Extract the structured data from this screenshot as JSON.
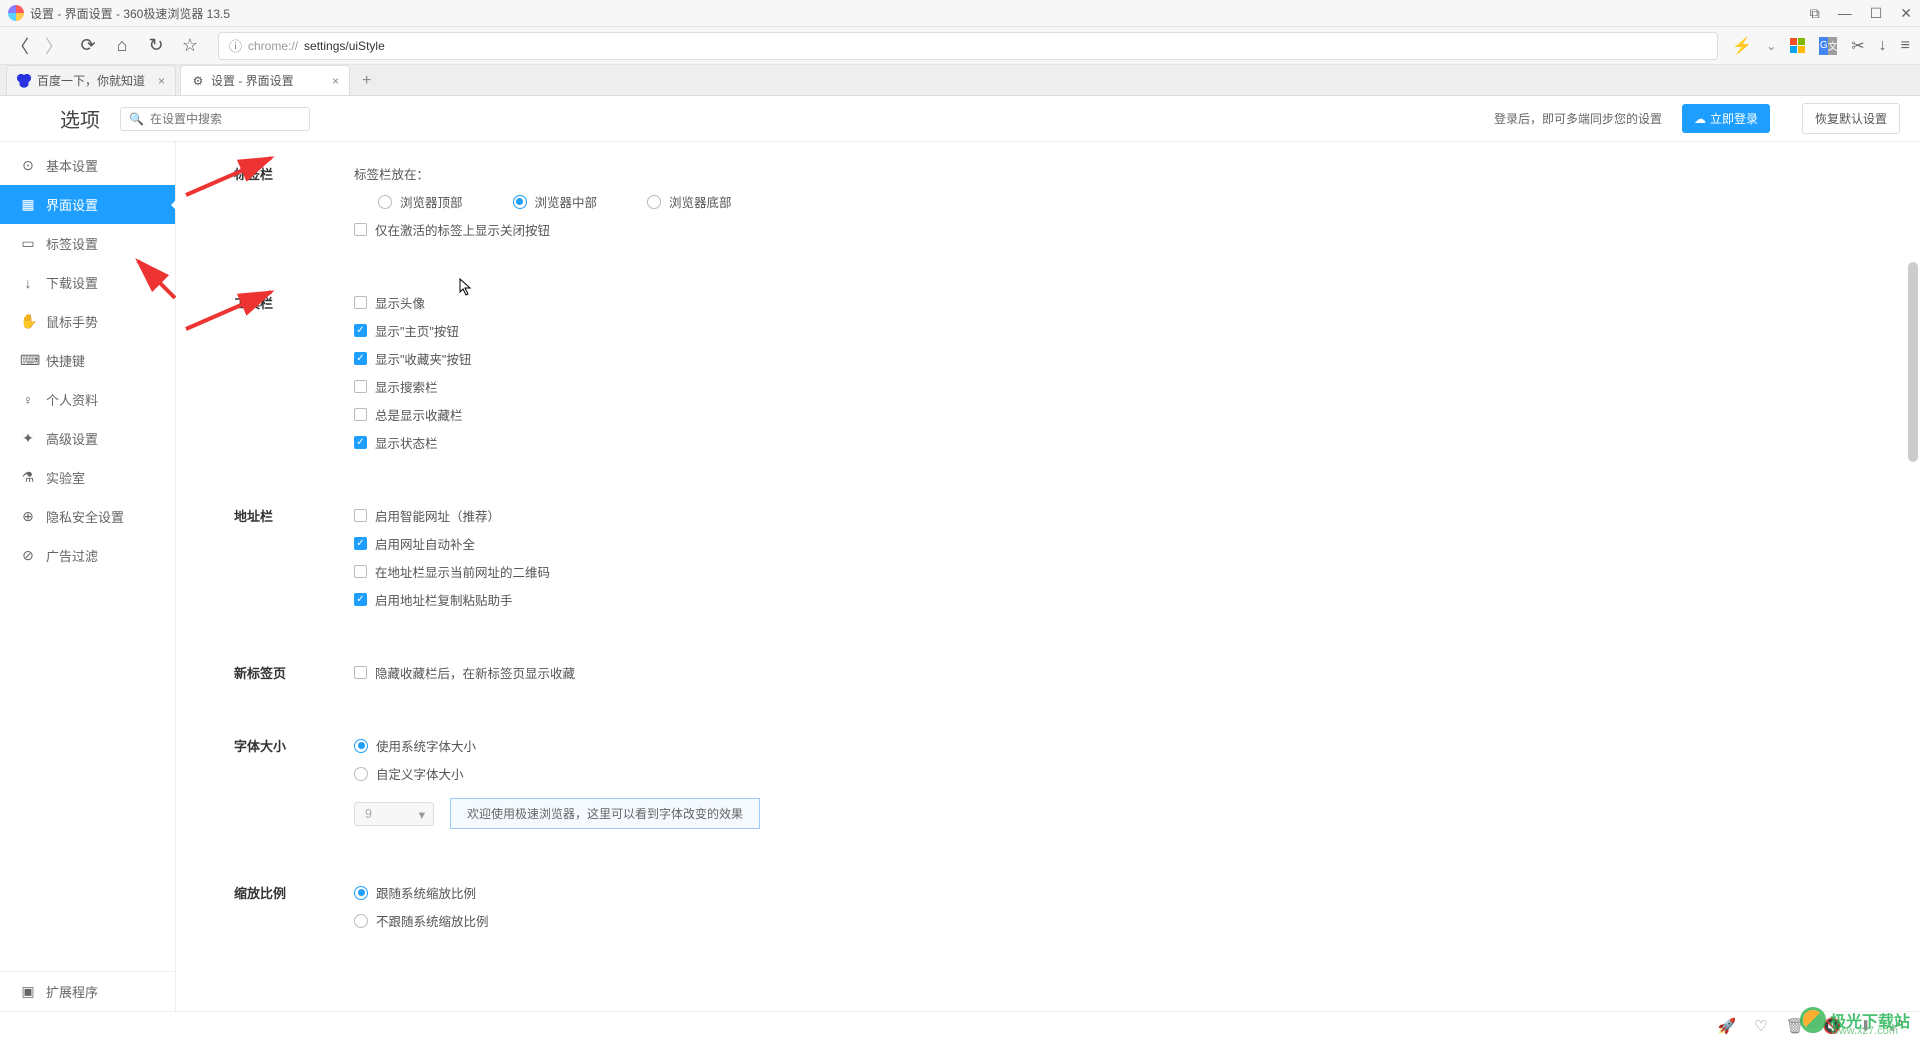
{
  "window": {
    "title": "设置 - 界面设置 - 360极速浏览器 13.5"
  },
  "address": {
    "prefix": "chrome://",
    "path": "settings/uiStyle"
  },
  "tabs": [
    {
      "label": "百度一下，你就知道",
      "active": false
    },
    {
      "label": "设置 - 界面设置",
      "active": true
    }
  ],
  "options_header": {
    "title": "选项",
    "search_placeholder": "在设置中搜索",
    "sync_hint": "登录后，即可多端同步您的设置",
    "login_button": "立即登录",
    "restore_button": "恢复默认设置"
  },
  "sidebar": {
    "items": [
      {
        "icon": "⊙",
        "label": "基本设置"
      },
      {
        "icon": "▦",
        "label": "界面设置"
      },
      {
        "icon": "▭",
        "label": "标签设置"
      },
      {
        "icon": "↓",
        "label": "下载设置"
      },
      {
        "icon": "✋",
        "label": "鼠标手势"
      },
      {
        "icon": "⌨",
        "label": "快捷键"
      },
      {
        "icon": "♀",
        "label": "个人资料"
      },
      {
        "icon": "✦",
        "label": "高级设置"
      },
      {
        "icon": "⚗",
        "label": "实验室"
      },
      {
        "icon": "⊕",
        "label": "隐私安全设置"
      },
      {
        "icon": "⊘",
        "label": "广告过滤"
      }
    ],
    "bottom": {
      "icon": "▣",
      "label": "扩展程序"
    }
  },
  "sections": {
    "tabbar": {
      "title": "标签栏",
      "position_label": "标签栏放在：",
      "positions": [
        "浏览器顶部",
        "浏览器中部",
        "浏览器底部"
      ],
      "checked_position_index": 1,
      "close_only_active": "仅在激活的标签上显示关闭按钮"
    },
    "toolbar": {
      "title": "工具栏",
      "items": [
        {
          "label": "显示头像",
          "checked": false
        },
        {
          "label": "显示\"主页\"按钮",
          "checked": true
        },
        {
          "label": "显示\"收藏夹\"按钮",
          "checked": true
        },
        {
          "label": "显示搜索栏",
          "checked": false
        },
        {
          "label": "总是显示收藏栏",
          "checked": false
        },
        {
          "label": "显示状态栏",
          "checked": true
        }
      ]
    },
    "addressbar": {
      "title": "地址栏",
      "items": [
        {
          "label": "启用智能网址（推荐）",
          "checked": false
        },
        {
          "label": "启用网址自动补全",
          "checked": true
        },
        {
          "label": "在地址栏显示当前网址的二维码",
          "checked": false
        },
        {
          "label": "启用地址栏复制粘贴助手",
          "checked": true
        }
      ]
    },
    "newtab": {
      "title": "新标签页",
      "item": {
        "label": "隐藏收藏栏后，在新标签页显示收藏",
        "checked": false
      }
    },
    "fontsize": {
      "title": "字体大小",
      "options": [
        "使用系统字体大小",
        "自定义字体大小"
      ],
      "checked_index": 0,
      "select_value": "9",
      "preview": "欢迎使用极速浏览器，这里可以看到字体改变的效果"
    },
    "zoom": {
      "title": "缩放比例",
      "options": [
        "跟随系统缩放比例",
        "不跟随系统缩放比例"
      ],
      "checked_index": 0
    }
  },
  "watermark": {
    "brand": "极光下载站",
    "url": "www.xz7.com"
  }
}
